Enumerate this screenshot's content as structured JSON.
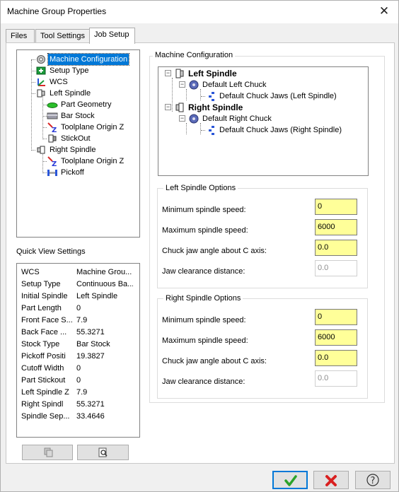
{
  "window": {
    "title": "Machine Group Properties",
    "close_glyph": "✕"
  },
  "tabs": [
    {
      "label": "Files"
    },
    {
      "label": "Tool Settings"
    },
    {
      "label": "Job Setup"
    }
  ],
  "left_tree": {
    "items": [
      {
        "label": "Machine Configuration",
        "icon": "machine-config-icon"
      },
      {
        "label": "Setup Type",
        "icon": "setup-type-icon"
      },
      {
        "label": "WCS",
        "icon": "wcs-axes-icon"
      },
      {
        "label": "Left Spindle",
        "icon": "spindle-icon"
      },
      {
        "label": "Part Geometry",
        "icon": "part-geometry-icon"
      },
      {
        "label": "Bar Stock",
        "icon": "bar-stock-icon"
      },
      {
        "label": "Toolplane Origin Z",
        "icon": "toolplane-origin-icon"
      },
      {
        "label": "StickOut",
        "icon": "stickout-icon"
      },
      {
        "label": "Right Spindle",
        "icon": "spindle-icon"
      },
      {
        "label": "Toolplane Origin Z",
        "icon": "toolplane-origin-icon"
      },
      {
        "label": "Pickoff",
        "icon": "pickoff-icon"
      }
    ]
  },
  "machine_config": {
    "title": "Machine Configuration",
    "tree": [
      {
        "label": "Left Spindle",
        "bold": true
      },
      {
        "label": "Default Left Chuck",
        "bold": false
      },
      {
        "label": "Default Chuck Jaws (Left Spindle)",
        "bold": false
      },
      {
        "label": "Right Spindle",
        "bold": true
      },
      {
        "label": "Default Right Chuck",
        "bold": false
      },
      {
        "label": "Default Chuck Jaws (Right Spindle)",
        "bold": false
      }
    ]
  },
  "left_options": {
    "title": "Left Spindle Options",
    "min_label": "Minimum spindle speed:",
    "min_value": "0",
    "max_label": "Maximum spindle speed:",
    "max_value": "6000",
    "chuck_label": "Chuck jaw angle about C axis:",
    "chuck_value": "0.0",
    "clear_label": "Jaw clearance distance:",
    "clear_value": "0.0"
  },
  "right_options": {
    "title": "Right Spindle Options",
    "min_label": "Minimum spindle speed:",
    "min_value": "0",
    "max_label": "Maximum spindle speed:",
    "max_value": "6000",
    "chuck_label": "Chuck jaw angle about C axis:",
    "chuck_value": "0.0",
    "clear_label": "Jaw clearance distance:",
    "clear_value": "0.0"
  },
  "quick_view": {
    "title": "Quick View Settings",
    "rows": [
      {
        "k": "WCS",
        "v": "Machine Grou..."
      },
      {
        "k": "Setup Type",
        "v": "Continuous Ba..."
      },
      {
        "k": "Initial Spindle",
        "v": "Left Spindle"
      },
      {
        "k": "Part Length",
        "v": "0"
      },
      {
        "k": "Front Face S...",
        "v": "7.9"
      },
      {
        "k": "Back Face ...",
        "v": "55.3271"
      },
      {
        "k": "Stock Type",
        "v": "Bar Stock"
      },
      {
        "k": "Pickoff Positi",
        "v": "19.3827"
      },
      {
        "k": "Cutoff Width",
        "v": "0"
      },
      {
        "k": "Part Stickout",
        "v": "0"
      },
      {
        "k": "Left Spindle Z",
        "v": "7.9"
      },
      {
        "k": "Right Spindl",
        "v": "55.3271"
      },
      {
        "k": "Spindle Sep...",
        "v": "33.4646"
      }
    ]
  },
  "colors": {
    "selection": "#0078d7",
    "field_highlight": "#ffff99",
    "ok_green": "#2ba32b",
    "cancel_red": "#d92020"
  }
}
